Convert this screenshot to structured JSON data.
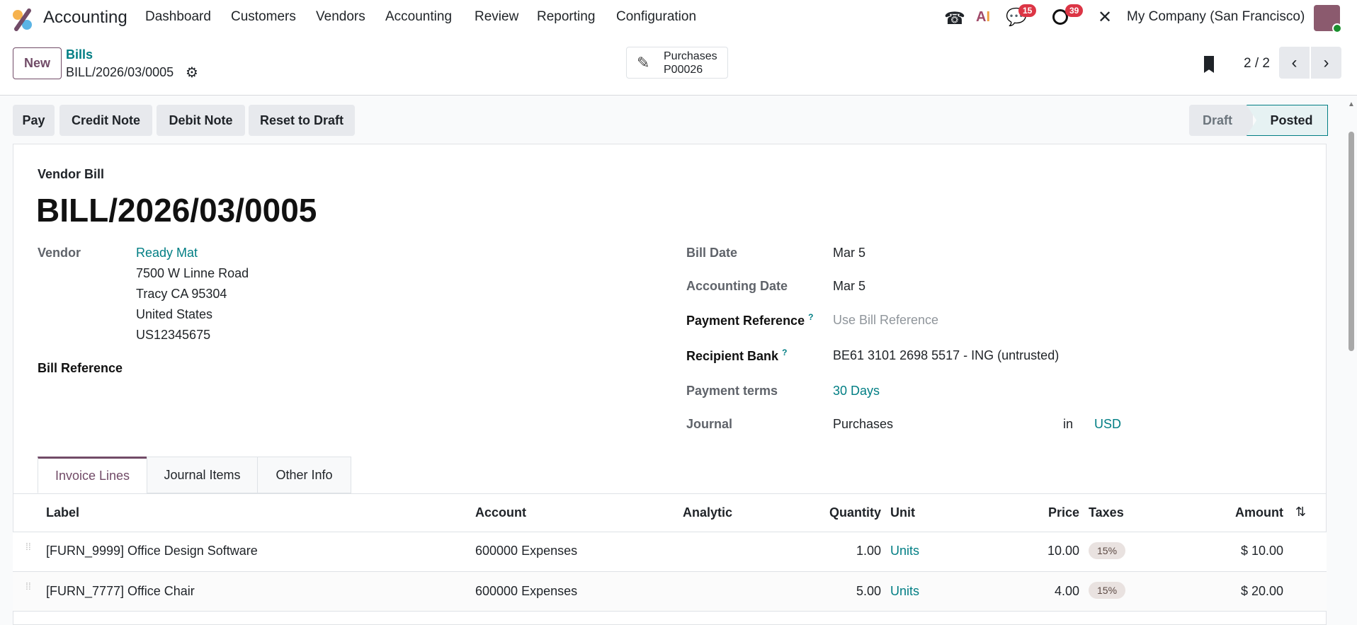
{
  "nav": {
    "app": "Accounting",
    "menu": [
      "Dashboard",
      "Customers",
      "Vendors",
      "Accounting",
      "Review",
      "Reporting",
      "Configuration"
    ],
    "messages_badge": "15",
    "activities_badge": "39",
    "company": "My Company (San Francisco)"
  },
  "control": {
    "new": "New",
    "breadcrumb": "Bills",
    "record": "BILL/2026/03/0005",
    "smart_button": {
      "label": "Purchases",
      "value": "P00026"
    },
    "pager": "2 / 2"
  },
  "actions": [
    "Pay",
    "Credit Note",
    "Debit Note",
    "Reset to Draft"
  ],
  "status": {
    "draft": "Draft",
    "posted": "Posted"
  },
  "form": {
    "type": "Vendor Bill",
    "title": "BILL/2026/03/0005",
    "vendor_label": "Vendor",
    "vendor_name": "Ready Mat",
    "vendor_address": [
      "7500 W Linne Road",
      "Tracy CA 95304",
      "United States",
      "US12345675"
    ],
    "bill_reference_label": "Bill Reference",
    "bill_date_label": "Bill Date",
    "bill_date": "Mar 5",
    "accounting_date_label": "Accounting Date",
    "accounting_date": "Mar 5",
    "payment_reference_label": "Payment Reference",
    "payment_reference_placeholder": "Use Bill Reference",
    "recipient_bank_label": "Recipient Bank",
    "recipient_bank": "BE61 3101 2698 5517 - ING (untrusted)",
    "payment_terms_label": "Payment terms",
    "payment_terms": "30 Days",
    "journal_label": "Journal",
    "journal": "Purchases",
    "in": "in",
    "currency": "USD",
    "help": "?"
  },
  "tabs": [
    "Invoice Lines",
    "Journal Items",
    "Other Info"
  ],
  "table": {
    "headers": {
      "label": "Label",
      "account": "Account",
      "analytic": "Analytic",
      "quantity": "Quantity",
      "unit": "Unit",
      "price": "Price",
      "taxes": "Taxes",
      "amount": "Amount"
    },
    "rows": [
      {
        "label": "[FURN_9999] Office Design Software",
        "account": "600000 Expenses",
        "quantity": "1.00",
        "unit": "Units",
        "price": "10.00",
        "tax": "15%",
        "amount": "$ 10.00"
      },
      {
        "label": "[FURN_7777] Office Chair",
        "account": "600000 Expenses",
        "quantity": "5.00",
        "unit": "Units",
        "price": "4.00",
        "tax": "15%",
        "amount": "$ 20.00"
      }
    ]
  }
}
